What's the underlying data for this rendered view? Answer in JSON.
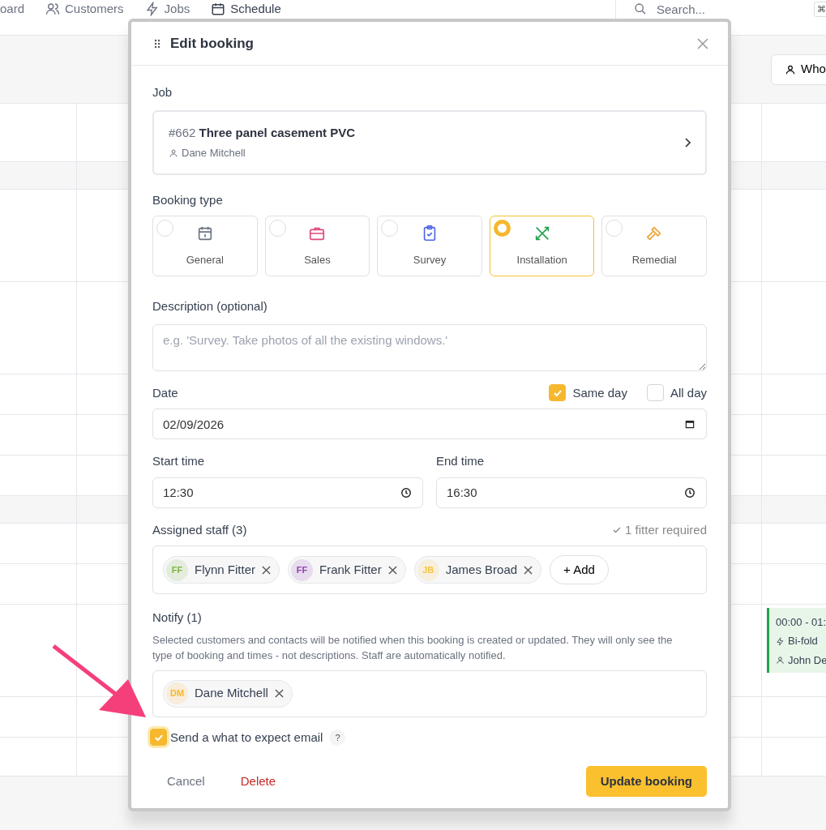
{
  "nav": {
    "items": [
      {
        "label": "oard",
        "selected": false
      },
      {
        "label": "Customers",
        "selected": false
      },
      {
        "label": "Jobs",
        "selected": false
      },
      {
        "label": "Schedule",
        "selected": true
      }
    ],
    "search": {
      "placeholder": "Search..."
    },
    "shortcut": "⌘"
  },
  "toolbar": {
    "button": "Who"
  },
  "event": {
    "time": "00:00 - 01:",
    "title": "Bi-fold",
    "person": "John De",
    "color": "#22a34a"
  },
  "modal": {
    "title": "Edit booking",
    "job": {
      "label": "Job",
      "number": "#662",
      "title": "Three panel casement PVC",
      "customer": "Dane Mitchell"
    },
    "booking_type": {
      "label": "Booking type",
      "types": [
        {
          "label": "General",
          "color": "#6b7280",
          "selected": false
        },
        {
          "label": "Sales",
          "color": "#e0467a",
          "selected": false
        },
        {
          "label": "Survey",
          "color": "#4f64e8",
          "selected": false
        },
        {
          "label": "Installation",
          "color": "#22a34a",
          "selected": true
        },
        {
          "label": "Remedial",
          "color": "#f0a030",
          "selected": false
        }
      ]
    },
    "description": {
      "label": "Description (optional)",
      "placeholder": "e.g. 'Survey. Take photos of all the existing windows.'"
    },
    "date": {
      "label": "Date",
      "value": "02/09/2026",
      "same_day": {
        "label": "Same day",
        "checked": true
      },
      "all_day": {
        "label": "All day",
        "checked": false
      }
    },
    "start_time": {
      "label": "Start time",
      "value": "12:30"
    },
    "end_time": {
      "label": "End time",
      "value": "16:30"
    },
    "staff": {
      "label": "Assigned staff (3)",
      "requirement": "1 fitter required",
      "add": "+ Add",
      "people": [
        {
          "initials": "FF",
          "name": "Flynn Fitter",
          "color": "#7cb342"
        },
        {
          "initials": "FF",
          "name": "Frank Fitter",
          "color": "#8e44ad"
        },
        {
          "initials": "JB",
          "name": "James Broad",
          "color": "#f5c542"
        }
      ]
    },
    "notify": {
      "label": "Notify (1)",
      "help": "Selected customers and contacts will be notified when this booking is created or updated. They will only see the type of booking and times - not descriptions. Staff are automatically notified.",
      "contacts": [
        {
          "initials": "DM",
          "name": "Dane Mitchell",
          "color": "#f5b82e"
        }
      ]
    },
    "email": {
      "label": "Send a what to expect email",
      "checked": true,
      "help": "?"
    },
    "buttons": {
      "cancel": "Cancel",
      "delete": "Delete",
      "submit": "Update booking"
    }
  }
}
